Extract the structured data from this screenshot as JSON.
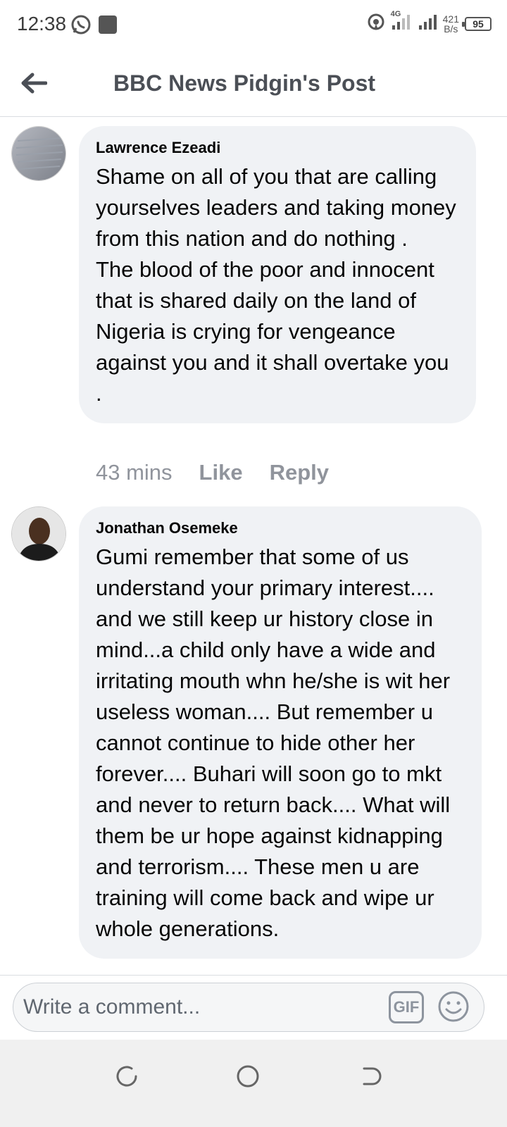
{
  "status_bar": {
    "time": "12:38",
    "network_type": "4G",
    "net_speed_value": "421",
    "net_speed_unit": "B/s",
    "battery": "95"
  },
  "header": {
    "title": "BBC News Pidgin's Post"
  },
  "comments": [
    {
      "author": "Lawrence Ezeadi",
      "text": "Shame on all of you that are calling yourselves leaders and taking money from this nation and do nothing .\nThe blood of the poor and innocent that is shared daily on the land of Nigeria is crying for vengeance against you and it shall overtake you .",
      "time": "43 mins",
      "like_label": "Like",
      "reply_label": "Reply"
    },
    {
      "author": "Jonathan Osemeke",
      "text": "Gumi remember that some of us understand your primary interest.... and we still keep ur history close in mind...a child only have a wide and irritating mouth whn he/she is wit her useless woman.... But remember u cannot continue to hide other her forever.... Buhari will soon go to mkt and never to return back.... What will them be ur hope against kidnapping and terrorism.... These men u are training will come back and wipe ur whole generations."
    }
  ],
  "composer": {
    "placeholder": "Write a comment...",
    "gif_label": "GIF"
  },
  "icons": {
    "back": "arrow-left-icon",
    "emoji": "smiley-icon",
    "whatsapp": "whatsapp-icon",
    "nav_recents": "recents-icon",
    "nav_home": "home-icon",
    "nav_back": "back-icon"
  },
  "colors": {
    "bubble": "#f0f2f5",
    "muted": "#90949c",
    "header_title": "#4b4f56"
  }
}
